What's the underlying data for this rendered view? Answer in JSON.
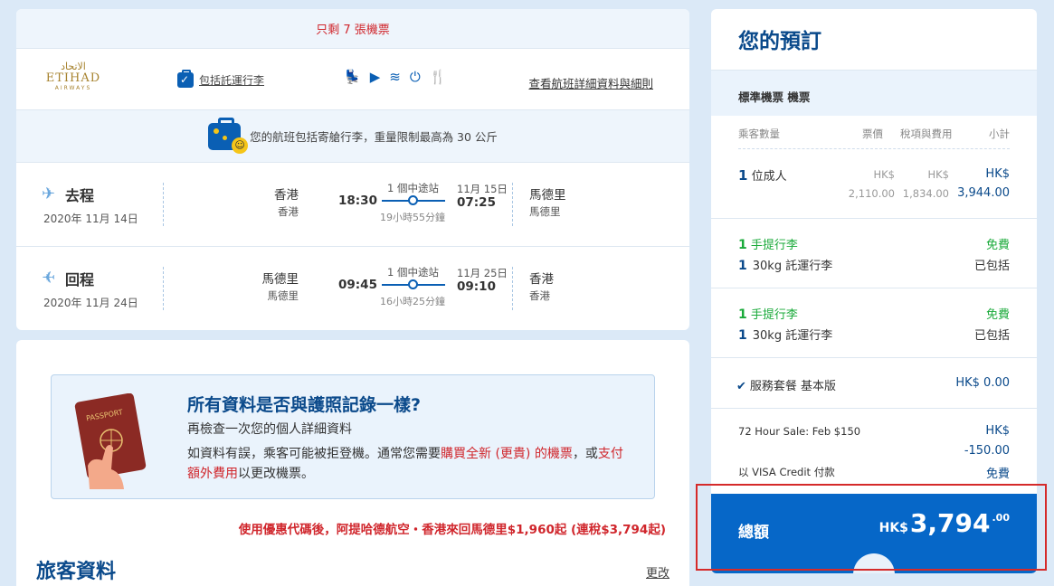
{
  "flight": {
    "seats_left": "只剩 7 張機票",
    "airline": {
      "logo_arabic": "الاتحاد",
      "logo_english": "ETIHAD",
      "logo_sub": "AIRWAYS"
    },
    "baggage_link": "包括託運行李",
    "details_link": "查看航班詳細資料與細則",
    "bag_info": "您的航班包括寄艙行李，重量限制最高為 30 公斤",
    "legs": [
      {
        "direction": "去程",
        "date": "2020年 11月 14日",
        "from_city": "香港",
        "from_sub": "香港",
        "dep_time": "18:30",
        "stops": "1 個中途站",
        "duration": "19小時55分鐘",
        "arr_date": "11月 15日",
        "arr_time": "07:25",
        "to_city": "馬德里",
        "to_sub": "馬德里"
      },
      {
        "direction": "回程",
        "date": "2020年 11月 24日",
        "from_city": "馬德里",
        "from_sub": "馬德里",
        "dep_time": "09:45",
        "stops": "1 個中途站",
        "duration": "16小時25分鐘",
        "arr_date": "11月 25日",
        "arr_time": "09:10",
        "to_city": "香港",
        "to_sub": "香港"
      }
    ]
  },
  "passport": {
    "title": "所有資料是否與護照記錄一樣?",
    "subtitle": "再檢查一次您的個人詳細資料",
    "text_1": "如資料有誤，乘客可能被拒登機。通常您需要",
    "link_1": "購買全新 (更貴) 的機票",
    "text_2": "，或",
    "link_2": "支付額外費用",
    "text_3": "以更改機票。",
    "image_label": "PASSPORT"
  },
  "promo": "使用優惠代碼後，阿提哈德航空・香港來回馬德里$1,960起 (連稅$3,794起)",
  "traveler": {
    "title": "旅客資料",
    "edit": "更改"
  },
  "booking": {
    "title": "您的預訂",
    "section": "標準機票 機票",
    "headers": {
      "qty": "乘客數量",
      "fare": "票價",
      "tax": "稅項與費用",
      "subtotal": "小計"
    },
    "passenger": {
      "count": "1",
      "label": "位成人",
      "fare_cur": "HK$",
      "fare": "2,110.00",
      "tax_cur": "HK$",
      "tax": "1,834.00",
      "sub_cur": "HK$",
      "sub": "3,944.00"
    },
    "baggage_groups": [
      {
        "hand_count": "1",
        "hand_label": "手提行李",
        "hand_price": "免費",
        "checked_count": "1",
        "checked_label": "30kg 託運行李",
        "checked_status": "已包括"
      },
      {
        "hand_count": "1",
        "hand_label": "手提行李",
        "hand_price": "免費",
        "checked_count": "1",
        "checked_label": "30kg 託運行李",
        "checked_status": "已包括"
      }
    ],
    "service": {
      "label": "服務套餐 基本版",
      "price": "HK$ 0.00"
    },
    "sale": {
      "label": "72 Hour Sale: Feb $150",
      "cur": "HK$",
      "amount": "-150.00"
    },
    "payment": {
      "label": "以 VISA Credit 付款",
      "price": "免費"
    },
    "total": {
      "label": "總額",
      "currency": "HK$",
      "amount": "3,794",
      "decimals": ".00"
    }
  },
  "colors": {
    "brand_blue": "#0667c8",
    "navy": "#0b4a8b",
    "alert_red": "#d0262c",
    "free_green": "#1aaa3a",
    "highlight": "#d52a2a"
  }
}
